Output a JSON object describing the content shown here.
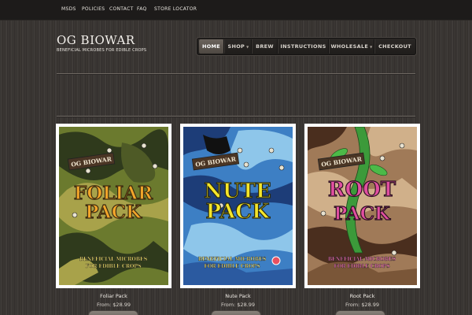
{
  "topbar": {
    "links": [
      "MSDS",
      "POLICIES",
      "CONTACT",
      "FAQ",
      "STORE LOCATOR"
    ]
  },
  "brand": {
    "title": "OG BIOWAR",
    "tagline": "BENEFICIAL MICROBES FOR EDIBLE CROPS"
  },
  "nav": {
    "items": [
      {
        "label": "HOME",
        "active": true,
        "dropdown": false
      },
      {
        "label": "SHOP",
        "active": false,
        "dropdown": true
      },
      {
        "label": "BREW",
        "active": false,
        "dropdown": false
      },
      {
        "label": "INSTRUCTIONS",
        "active": false,
        "dropdown": false
      },
      {
        "label": "WHOLESALE",
        "active": false,
        "dropdown": true
      },
      {
        "label": "CHECKOUT",
        "active": false,
        "dropdown": false
      }
    ]
  },
  "products": [
    {
      "name": "Foliar Pack",
      "price": "From: $28.99",
      "art": {
        "brand": "OG BIOWAR",
        "line1": "FOLIAR",
        "line2": "PACK",
        "tagline1": "BENEFICIAL MICROBES",
        "tagline2": "FOR EDIBLE CROPS",
        "camo": [
          "#6b7a2e",
          "#2f3a1c",
          "#a8a24a",
          "#4e5a26"
        ],
        "title_color": "#f2a52a"
      }
    },
    {
      "name": "Nute Pack",
      "price": "From: $28.99",
      "art": {
        "brand": "OG BIOWAR",
        "line1": "NUTE",
        "line2": "PACK",
        "tagline1": "BENEFICIAL MICROBES",
        "tagline2": "FOR EDIBLE CROPS",
        "camo": [
          "#3d7fc4",
          "#1d3d78",
          "#8ec6ea",
          "#2b5aa0"
        ],
        "title_color": "#f5e62a"
      }
    },
    {
      "name": "Root Pack",
      "price": "From: $28.99",
      "art": {
        "brand": "OG BIOWAR",
        "line1": "ROOT",
        "line2": "PACK",
        "tagline1": "BENEFICIAL MICROBES",
        "tagline2": "FOR EDIBLE CROPS",
        "camo": [
          "#a07a58",
          "#4a2e1e",
          "#d0b08a",
          "#7a5638"
        ],
        "title_color": "#e04fa0"
      }
    }
  ]
}
